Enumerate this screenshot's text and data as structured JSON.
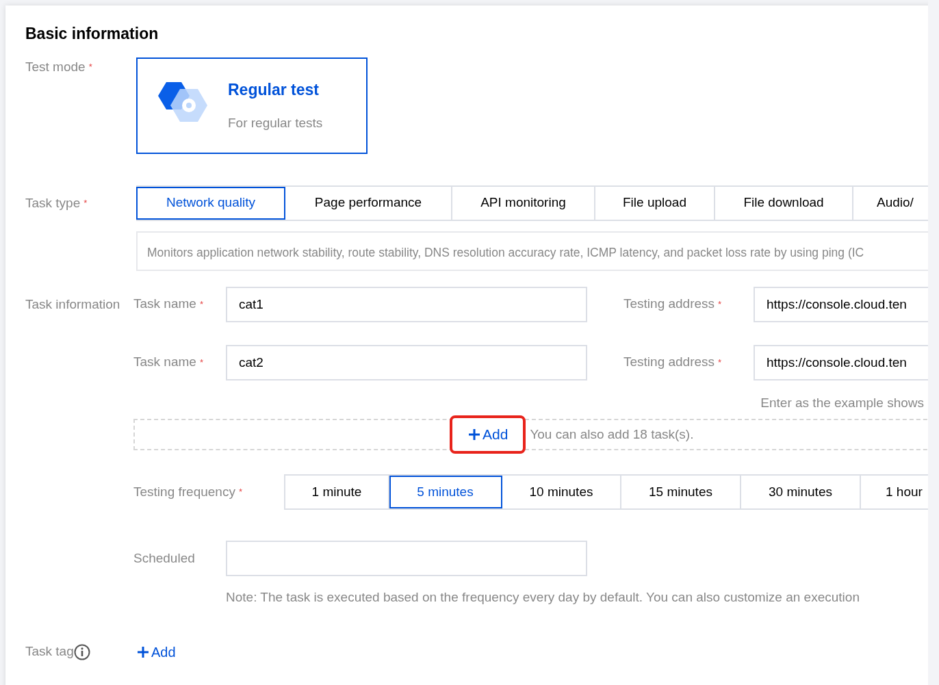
{
  "section_title": "Basic information",
  "test_mode": {
    "label": "Test mode",
    "required_mark": "*",
    "options": [
      {
        "title": "Regular test",
        "description": "For regular tests",
        "selected": true
      }
    ]
  },
  "task_type": {
    "label": "Task type",
    "required_mark": "*",
    "tabs": [
      {
        "label": "Network quality",
        "selected": true
      },
      {
        "label": "Page performance",
        "selected": false
      },
      {
        "label": "API monitoring",
        "selected": false
      },
      {
        "label": "File upload",
        "selected": false
      },
      {
        "label": "File download",
        "selected": false
      },
      {
        "label": "Audio/",
        "selected": false
      }
    ],
    "description": "Monitors application network stability, route stability, DNS resolution accuracy rate, ICMP latency, and packet loss rate by using ping (IC"
  },
  "task_information": {
    "label": "Task information",
    "tasks": [
      {
        "name_label": "Task name",
        "name_mark": "*",
        "name_value": "cat1",
        "address_label": "Testing address",
        "address_mark": "*",
        "address_value": "https://console.cloud.ten"
      },
      {
        "name_label": "Task name",
        "name_mark": "*",
        "name_value": "cat2",
        "address_label": "Testing address",
        "address_mark": "*",
        "address_value": "https://console.cloud.ten"
      }
    ],
    "address_hint": "Enter as the example shows",
    "add_button": {
      "label": "Add",
      "highlighted": true
    },
    "add_hint": "You can also add 18 task(s)."
  },
  "testing_frequency": {
    "label": "Testing frequency",
    "required_mark": "*",
    "options": [
      {
        "label": "1 minute",
        "selected": false
      },
      {
        "label": "5 minutes",
        "selected": true
      },
      {
        "label": "10 minutes",
        "selected": false
      },
      {
        "label": "15 minutes",
        "selected": false
      },
      {
        "label": "30 minutes",
        "selected": false
      },
      {
        "label": "1 hour",
        "selected": false
      }
    ]
  },
  "scheduled": {
    "label": "Scheduled",
    "note": "Note: The task is executed based on the frequency every day by default. You can also customize an execution"
  },
  "task_tag": {
    "label": "Task tag",
    "add_button": {
      "label": "Add"
    }
  }
}
